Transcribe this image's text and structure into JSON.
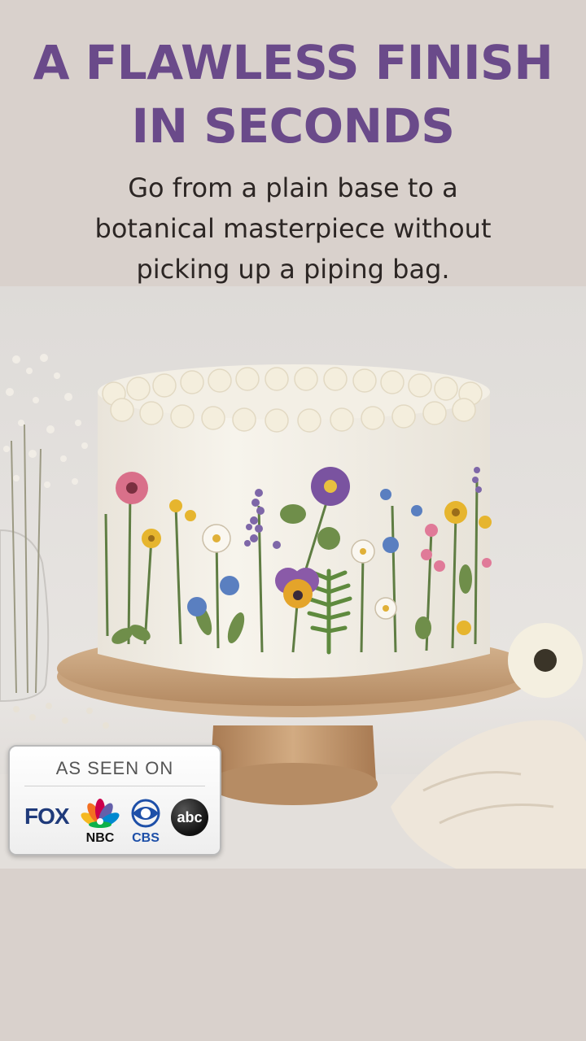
{
  "headline": {
    "line1": "A FLAWLESS FINISH",
    "line2": "IN SECONDS"
  },
  "subhead": {
    "line1": "Go from a plain base to a",
    "line2": "botanical masterpiece without",
    "line3": "picking up a piping bag."
  },
  "badge": {
    "title": "AS SEEN ON",
    "logos": {
      "fox": "FOX",
      "nbc": "NBC",
      "cbs": "CBS",
      "abc": "abc"
    }
  },
  "colors": {
    "page_background": "#d9d1cc",
    "headline": "#6a4a8a",
    "body_text": "#2c2624"
  },
  "icons": [
    "nbc-peacock-icon",
    "cbs-eye-icon"
  ]
}
